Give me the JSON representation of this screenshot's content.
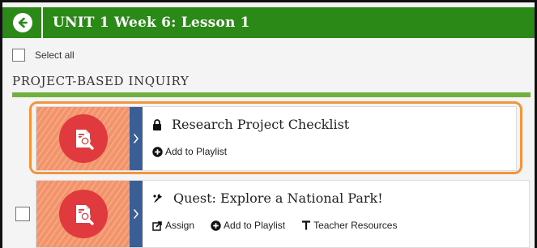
{
  "header": {
    "title": "UNIT 1 Week 6: Lesson 1",
    "back_icon": "arrow-left-icon"
  },
  "select_all": {
    "label": "Select all"
  },
  "section": {
    "title": "PROJECT-BASED INQUIRY",
    "accent": "#72b043"
  },
  "items": [
    {
      "title": "Research Project Checklist",
      "title_icon": "lock-icon",
      "actions": {
        "add_playlist": "Add to Playlist"
      }
    },
    {
      "title": "Quest: Explore a National Park!",
      "title_icon": "quest-icon",
      "actions": {
        "assign": "Assign",
        "add_playlist": "Add to Playlist",
        "teacher_resources": "Teacher Resources"
      }
    }
  ],
  "colors": {
    "header_green": "#2b8a17",
    "thumb_orange": "#f3936a",
    "resource_red": "#e03a3e",
    "expander_blue": "#3b5f94",
    "highlight_orange": "#f2953f"
  }
}
